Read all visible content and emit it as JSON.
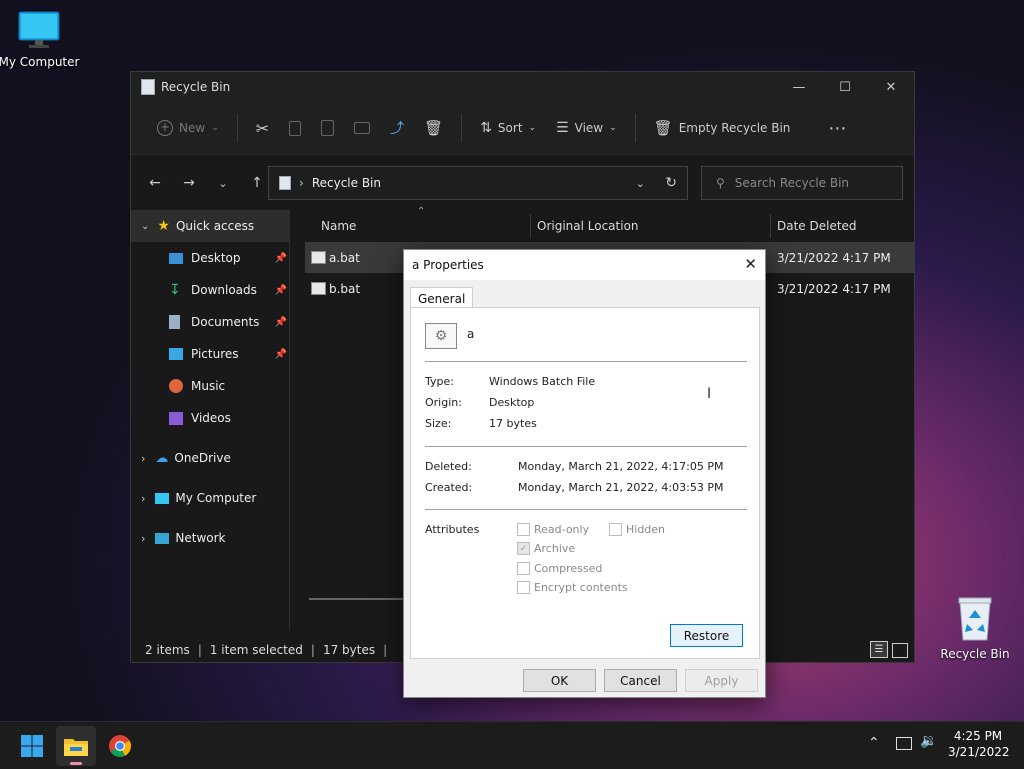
{
  "desktop": {
    "icons": [
      {
        "label": "My Computer",
        "icon": "monitor-icon"
      },
      {
        "label": "Recycle Bin",
        "icon": "recycle-bin-icon"
      }
    ]
  },
  "explorer": {
    "title": "Recycle Bin",
    "toolbar": {
      "new_label": "New",
      "sort_label": "Sort",
      "view_label": "View",
      "empty_label": "Empty Recycle Bin"
    },
    "address": "Recycle Bin",
    "search_placeholder": "Search Recycle Bin",
    "sidebar": {
      "quick_access": "Quick access",
      "items": [
        {
          "label": "Desktop",
          "pinned": true,
          "icon": "desktop-folder-icon"
        },
        {
          "label": "Downloads",
          "pinned": true,
          "icon": "download-icon"
        },
        {
          "label": "Documents",
          "pinned": true,
          "icon": "documents-icon"
        },
        {
          "label": "Pictures",
          "pinned": true,
          "icon": "pictures-icon"
        },
        {
          "label": "Music",
          "pinned": false,
          "icon": "music-icon"
        },
        {
          "label": "Videos",
          "pinned": false,
          "icon": "videos-icon"
        }
      ],
      "onedrive": "OneDrive",
      "my_computer": "My Computer",
      "network": "Network"
    },
    "columns": {
      "name": "Name",
      "original_location": "Original Location",
      "date_deleted": "Date Deleted"
    },
    "files": [
      {
        "name": "a.bat",
        "date_deleted": "3/21/2022 4:17 PM",
        "selected": true
      },
      {
        "name": "b.bat",
        "date_deleted": "3/21/2022 4:17 PM",
        "selected": false
      }
    ],
    "status": {
      "items": "2 items",
      "selected": "1 item selected",
      "size": "17 bytes"
    }
  },
  "dialog": {
    "title": "a Properties",
    "tab": "General",
    "file_name": "a",
    "type_label": "Type:",
    "type_value": "Windows Batch File",
    "origin_label": "Origin:",
    "origin_value": "Desktop",
    "size_label": "Size:",
    "size_value": "17 bytes",
    "deleted_label": "Deleted:",
    "deleted_value": "Monday, March 21, 2022, 4:17:05 PM",
    "created_label": "Created:",
    "created_value": "Monday, March 21, 2022, 4:03:53 PM",
    "attributes_label": "Attributes",
    "attributes": {
      "read_only": "Read-only",
      "hidden": "Hidden",
      "archive": "Archive",
      "compressed": "Compressed",
      "encrypt": "Encrypt contents"
    },
    "restore": "Restore",
    "ok": "OK",
    "cancel": "Cancel",
    "apply": "Apply"
  },
  "taskbar": {
    "time": "4:25 PM",
    "date": "3/21/2022"
  },
  "colors": {
    "accent": "#0078d4",
    "window_bg": "#191919",
    "taskbar_bg": "#1c1c1c"
  }
}
